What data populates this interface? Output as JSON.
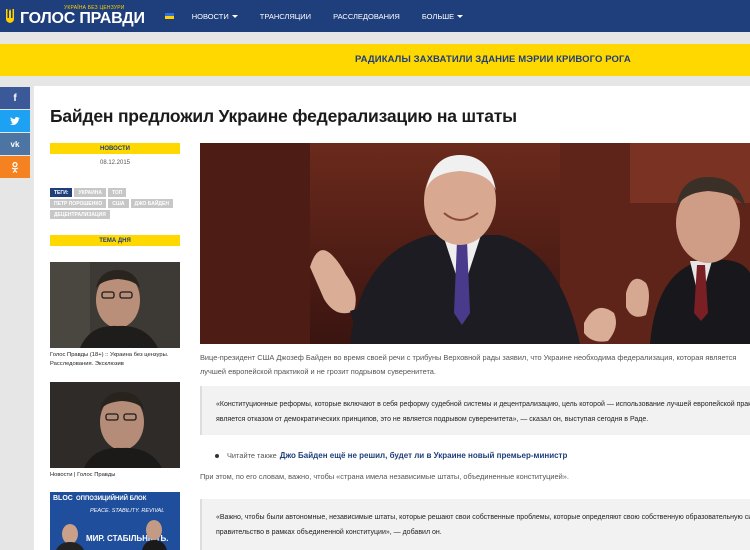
{
  "header": {
    "tagline": "УКРАЇНА БЕЗ ЦЕНЗУРИ",
    "site_title": "ГОЛОС ПРАВДИ",
    "nav": [
      {
        "label": "НОВОСТИ",
        "dropdown": true
      },
      {
        "label": "ТРАНСЛЯЦИИ",
        "dropdown": false
      },
      {
        "label": "РАССЛЕДОВАНИЯ",
        "dropdown": false
      },
      {
        "label": "БОЛЬШЕ",
        "dropdown": true
      }
    ],
    "colors": {
      "bar": "#1f3e7c",
      "accent": "#ffd800"
    }
  },
  "banner": {
    "text": "РАДИКАЛЫ ЗАХВАТИЛИ ЗДАНИЕ МЭРИИ КРИВОГО РОГА"
  },
  "share": [
    {
      "icon": "facebook-icon",
      "glyph": "f",
      "color": "#3b5998"
    },
    {
      "icon": "twitter-icon",
      "glyph": "t",
      "color": "#1da1f2"
    },
    {
      "icon": "vk-icon",
      "glyph": "vk",
      "color": "#4c75a3"
    },
    {
      "icon": "odnoklassniki-icon",
      "glyph": "ok",
      "color": "#f58220"
    }
  ],
  "article": {
    "title": "Байден предложил Украине федерализацию на штаты",
    "category": "НОВОСТИ",
    "date": "08.12.2015",
    "tags_label": "ТЕГИ:",
    "tags": [
      "УКРАИНА",
      "ТОП",
      "ПЕТР ПОРОШЕНКО",
      "США",
      "ДЖО БАЙДЕН",
      "ДЕЦЕНТРАЛИЗАЦИЯ"
    ],
    "lead": "Вице-президент США Джозеф Байден во время своей речи с трибуны Верховной рады заявил, что Украине необходима федерализация, которая является лучшей европейской практикой и не грозит подрывом суверенитета.",
    "quote1": [
      "«Конституционные реформы, которые включают в себя реформу судебной системы и децентрализацию, цель которой — использование лучшей европейской практик",
      "является отказом от демократических принципов, это не является подрывом суверенитета», — сказал он, выступая сегодня в Раде."
    ],
    "read_also_label": "Читайте также",
    "read_also_link": "Джо Байден ещё не решил, будет ли в Украине новый премьер-министр",
    "paragraph": "При этом, по его словам, важно, чтобы «страна имела независимые штаты, объединенные конституцией».",
    "quote2": [
      "«Важно, чтобы были автономные, независимые штаты, которые решают свои собственные проблемы, которые определяют свою собственную образовательную систе",
      "правительство в рамках объединенной конституции», — добавил он."
    ]
  },
  "sidebar": {
    "topic_title": "ТЕМА ДНЯ",
    "items": [
      {
        "caption_line1": "Голос Правды (18+) :: Украина без цензуры.",
        "caption_line2": "Расследования. Эксклюзив"
      },
      {
        "caption_line1": "Новости | Голос Правды",
        "caption_line2": ""
      },
      {
        "thumb_tag": "BLOC",
        "thumb_title": "ОППОЗИЦИЙНИЙ БЛОК",
        "thumb_slogan": "PEACE. STABILITY. REVIVAL",
        "thumb_bottom": "МИР. СТАБІЛЬНІСТЬ."
      }
    ]
  }
}
